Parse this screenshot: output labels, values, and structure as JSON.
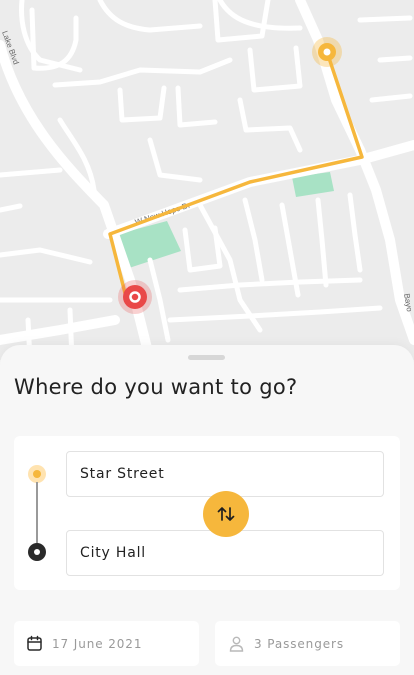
{
  "map": {
    "street_labels": [
      "W New Hope Dr",
      "Lake Blvd",
      "Bayo"
    ],
    "route_color": "#f6b73c",
    "park_color": "#a8e2c5",
    "origin_pin": "origin-marker-icon",
    "destination_pin": "destination-marker-icon"
  },
  "sheet": {
    "heading": "Where do you want to go?",
    "from": {
      "value": "Star Street",
      "icon": "origin-dot-icon"
    },
    "to": {
      "value": "City Hall",
      "icon": "destination-dot-icon"
    },
    "swap_icon": "swap-arrows-icon",
    "date": {
      "value": "17 June 2021",
      "icon": "calendar-icon"
    },
    "passengers": {
      "value": "3 Passengers",
      "icon": "person-icon"
    }
  },
  "colors": {
    "accent": "#f6b73c",
    "destination": "#e94848",
    "text": "#222222",
    "muted": "#9a9a9a"
  }
}
